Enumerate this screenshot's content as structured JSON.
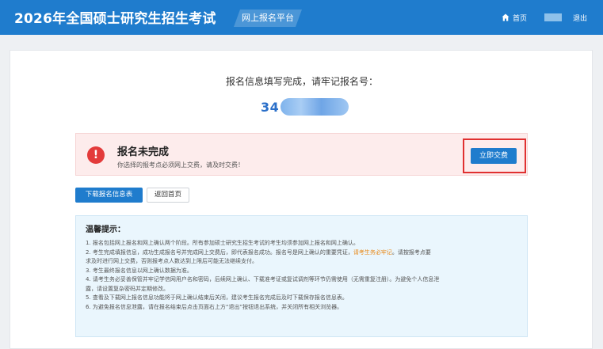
{
  "header": {
    "site_title": "2026年全国硕士研究生招生考试",
    "platform_tag": "网上报名平台",
    "nav_home": "首页",
    "nav_logout": "退出"
  },
  "result": {
    "title": "报名信息填写完成，请牢记报名号：",
    "reg_number_prefix": "34"
  },
  "alert": {
    "icon": "!",
    "title": "报名未完成",
    "subtitle": "你选择的报考点必须网上交费，请及时交费！",
    "pay_button": "立即交费"
  },
  "actions": {
    "download_label": "下载报名信息表",
    "home_label": "返回首页"
  },
  "tips": {
    "title": "温馨提示：",
    "line1": "1. 报名包括网上报名和网上确认两个阶段。所有参加硕士研究生招生考试的考生均须参加网上报名和网上确认。",
    "line2_a": "2. 考生完成填报信息，成功生成报名号并完成网上交费后，即代表报名成功。报名号是网上确认的重要凭证，",
    "line2_em": "请考生务必牢记",
    "line2_b": "。请按报考点要",
    "line3": "求及时进行网上交费，否则报考点人数达到上限后可能无法继续支付。",
    "line4": "3. 考生最终报名信息以网上确认数据为准。",
    "line5": "4. 请考生务必妥善保管并牢记学信网用户名和密码，后续网上确认、下载准考证或复试调剂等环节仍需使用（无需重复注册）。为避免个人信息泄",
    "line6": "露，请设置复杂密码并定期修改。",
    "line7": "5. 查看及下载网上报名信息功能将于网上确认结束后关闭，建议考生报名完成后及时下载保存报名信息表。",
    "line8": "6. 为避免报名信息泄露，请在报名结束后点击页面右上方“退出”按钮退出系统，并关闭所有相关浏览器。"
  },
  "colors": {
    "primary": "#1f7ccd",
    "alert_bg": "#fdecec",
    "alert_icon": "#e33b3b",
    "highlight_border": "#e03030",
    "tips_bg": "#eaf6fd",
    "emphasis": "#e88a1a"
  }
}
